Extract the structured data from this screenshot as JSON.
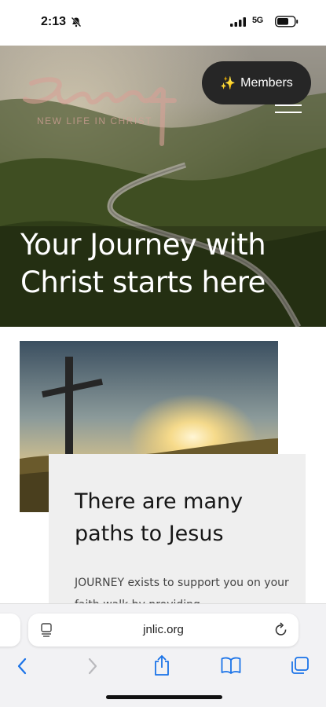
{
  "status_bar": {
    "time": "2:13",
    "network": "5G",
    "icons": [
      "bell-slash-icon",
      "signal-icon",
      "battery-icon"
    ]
  },
  "hero": {
    "logo_text": "Journey",
    "tagline": "NEW LIFE IN CHRIST",
    "members_label": "Members",
    "members_icon": "sparkles-icon",
    "title": "Your Journey with Christ starts here"
  },
  "content": {
    "card_title": "There are many paths to Jesus",
    "card_body": "JOURNEY exists to support you on your faith walk by providing"
  },
  "browser": {
    "url": "jnlic.org",
    "toolbar_icons": [
      "back-icon",
      "forward-icon",
      "share-icon",
      "bookmarks-icon",
      "tabs-icon"
    ]
  },
  "colors": {
    "members_bg": "#262626",
    "card_bg": "#efefef",
    "toolbar_accent": "#1a73e8"
  }
}
